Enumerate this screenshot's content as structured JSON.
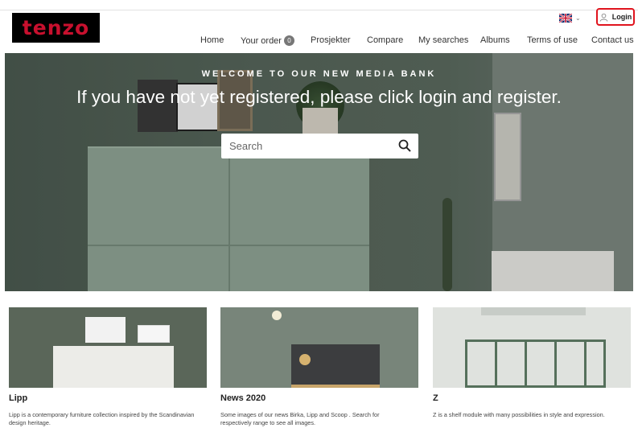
{
  "brand": {
    "logo_text": "tenzo",
    "logo_bg": "#000000",
    "logo_color": "#c8102e"
  },
  "header": {
    "language_icon": "uk-flag-icon",
    "login_label": "Login",
    "login_highlight_color": "#e0141e"
  },
  "nav": {
    "home": "Home",
    "your_order": "Your order",
    "order_count": "0",
    "projects": "Prosjekter",
    "compare": "Compare",
    "my_searches": "My searches",
    "albums": "Albums",
    "terms": "Terms of use",
    "contact": "Contact us"
  },
  "hero": {
    "kicker": "WELCOME TO OUR NEW MEDIA BANK",
    "title": "If you have not yet registered, please click login and register.",
    "search_placeholder": "Search",
    "search_icon": "search-icon"
  },
  "cards": [
    {
      "title": "Lipp",
      "text": "Lipp is a contemporary furniture collection inspired by the Scandinavian design heritage."
    },
    {
      "title": "News 2020",
      "text": "Some images of our news Birka, Lipp and Scoop . Search for respectively range to see all images."
    },
    {
      "title": "Z",
      "text": "Z is a shelf module with many possibilities in style and expression."
    }
  ]
}
